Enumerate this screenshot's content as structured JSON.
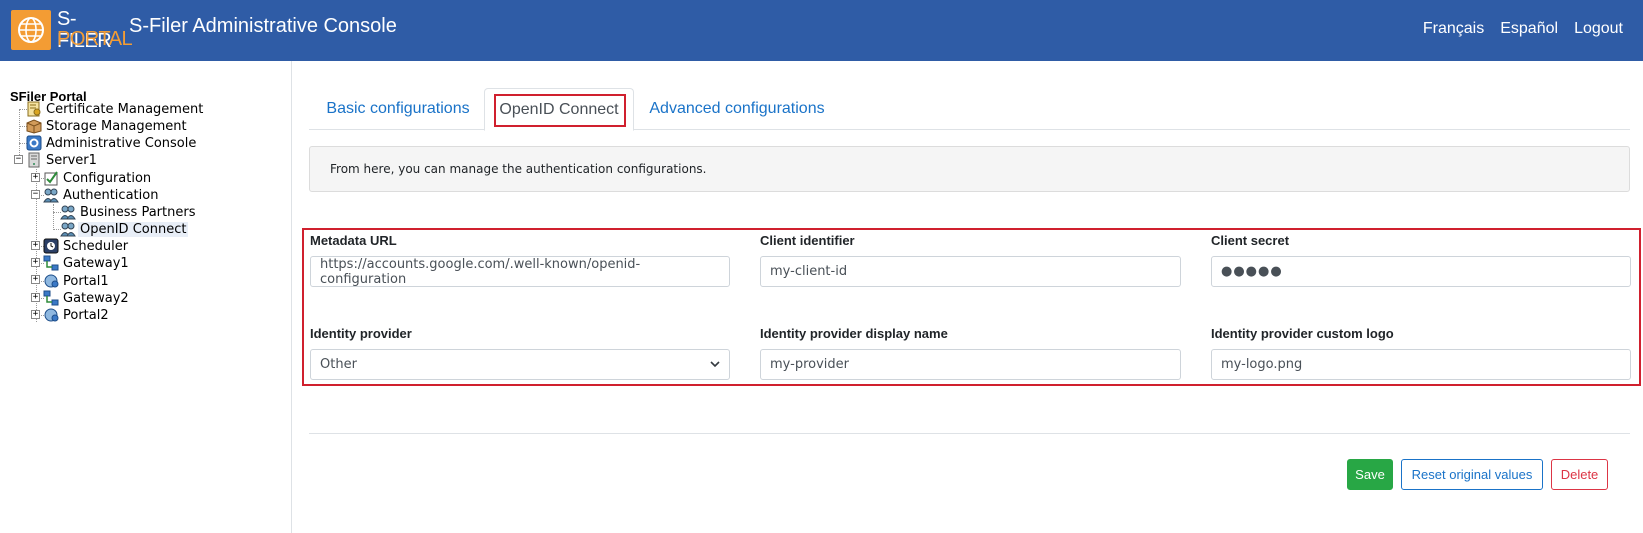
{
  "header": {
    "logo_line1": "S-FILER",
    "logo_line2": "PORTAL",
    "title": "S-Filer Administrative Console",
    "links": [
      "Français",
      "Español",
      "Logout"
    ]
  },
  "tree": {
    "root": "SFiler Portal",
    "nodes": [
      {
        "label": "Certificate Management",
        "icon": "certificate-icon"
      },
      {
        "label": "Storage Management",
        "icon": "storage-box-icon"
      },
      {
        "label": "Administrative Console",
        "icon": "console-icon"
      },
      {
        "label": "Server1",
        "icon": "server-icon",
        "expander": "−"
      },
      {
        "label": "Configuration",
        "icon": "configuration-icon",
        "expander": "+"
      },
      {
        "label": "Authentication",
        "icon": "users-icon",
        "expander": "−"
      },
      {
        "label": "Business Partners",
        "icon": "users-icon"
      },
      {
        "label": "OpenID Connect",
        "icon": "users-icon",
        "selected": true
      },
      {
        "label": "Scheduler",
        "icon": "scheduler-icon",
        "expander": "+"
      },
      {
        "label": "Gateway1",
        "icon": "gateway-icon",
        "expander": "+"
      },
      {
        "label": "Portal1",
        "icon": "portal-icon",
        "expander": "+"
      },
      {
        "label": "Gateway2",
        "icon": "gateway-icon",
        "expander": "+"
      },
      {
        "label": "Portal2",
        "icon": "portal-icon",
        "expander": "+"
      }
    ]
  },
  "tabs": [
    {
      "label": "Basic configurations"
    },
    {
      "label": "OpenID Connect",
      "active": true
    },
    {
      "label": "Advanced configurations"
    }
  ],
  "info": "From here, you can manage the authentication configurations.",
  "form": {
    "metadata_url": {
      "label": "Metadata URL",
      "value": "https://accounts.google.com/.well-known/openid-configuration"
    },
    "client_id": {
      "label": "Client identifier",
      "value": "my-client-id"
    },
    "client_secret": {
      "label": "Client secret",
      "value": "●●●●●"
    },
    "identity_provider": {
      "label": "Identity provider",
      "value": "Other"
    },
    "display_name": {
      "label": "Identity provider display name",
      "value": "my-provider"
    },
    "custom_logo": {
      "label": "Identity provider custom logo",
      "value": "my-logo.png"
    }
  },
  "buttons": {
    "save": "Save",
    "reset": "Reset original values",
    "delete": "Delete"
  },
  "colors": {
    "header_bg": "#2f5ca6",
    "logo_orange": "#f39c34",
    "link_blue": "#1a73c8",
    "highlight_red": "#d0202e",
    "save_green": "#28a745",
    "delete_red": "#dc3545"
  }
}
